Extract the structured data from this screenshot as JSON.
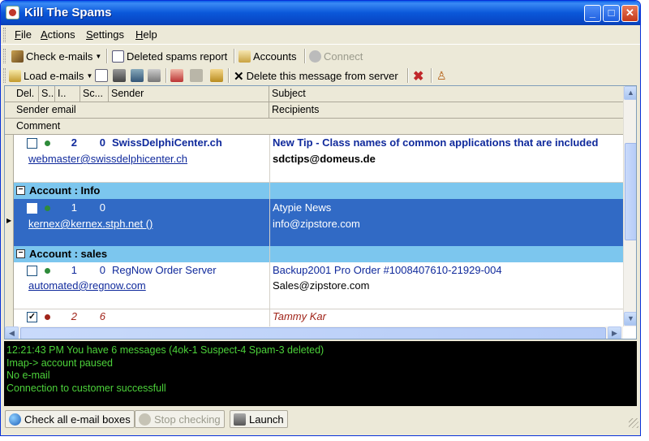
{
  "window": {
    "title": "Kill The Spams"
  },
  "menu": [
    "File",
    "Actions",
    "Settings",
    "Help"
  ],
  "toolbar1": {
    "check_emails": "Check e-mails",
    "deleted_report": "Deleted spams report",
    "accounts": "Accounts",
    "connect": "Connect"
  },
  "toolbar2": {
    "load_emails": "Load e-mails",
    "delete_from_server": "Delete this message from server"
  },
  "grid": {
    "headers_row1": [
      "Del.",
      "S..",
      "I..",
      "Sc...",
      "Sender",
      "Subject"
    ],
    "headers_row2": [
      "Sender email",
      "Recipients"
    ],
    "headers_row3": [
      "Comment"
    ],
    "messages": [
      {
        "size": "2",
        "score": "0",
        "sender": "SwissDelphiCenter.ch",
        "subject": "New Tip - Class names of common applications that are included",
        "email": "webmaster@swissdelphicenter.ch",
        "recipients": "sdctips@domeus.de",
        "bold": true,
        "status_color": "#2e8b3a"
      }
    ],
    "groups": [
      {
        "label": "Account : Info",
        "messages": [
          {
            "size": "1",
            "score": "0",
            "sender": "",
            "subject": "Atypie News",
            "email": "kernex@kernex.stph.net ()",
            "recipients": "info@zipstore.com",
            "selected": true,
            "status_color": "#2e8b3a"
          }
        ]
      },
      {
        "label": "Account : sales",
        "messages": [
          {
            "size": "1",
            "score": "0",
            "sender": "RegNow Order Server",
            "subject": "Backup2001 Pro Order #1008407610-21929-004",
            "email": "automated@regnow.com",
            "recipients": "Sales@zipstore.com",
            "status_color": "#2e8b3a"
          },
          {
            "size": "2",
            "score": "6",
            "sender": "",
            "subject": "Tammy Kar",
            "email": "",
            "recipients": "",
            "spam": true,
            "status_color": "#a0241a"
          }
        ]
      }
    ]
  },
  "log": [
    "12:21:43 PM You have 6 messages (4ok-1 Suspect-4 Spam-3 deleted)",
    "Imap-> account paused",
    "No e-mail",
    "Connection to customer successfull"
  ],
  "bottom": {
    "check_all": "Check all e-mail boxes",
    "stop": "Stop checking",
    "launch": "Launch"
  }
}
